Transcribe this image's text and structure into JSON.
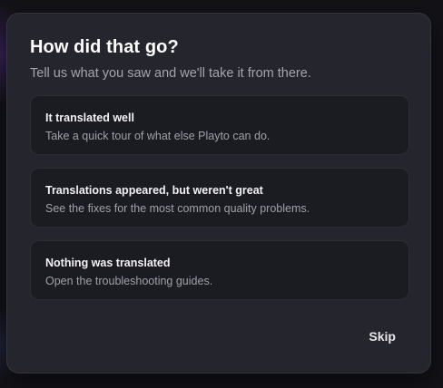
{
  "dialog": {
    "title": "How did that go?",
    "subtitle": "Tell us what you saw and we'll take it from there.",
    "options": [
      {
        "title": "It translated well",
        "description": "Take a quick tour of what else Playto can do."
      },
      {
        "title": "Translations appeared, but weren't great",
        "description": "See the fixes for the most common quality problems."
      },
      {
        "title": "Nothing was translated",
        "description": "Open the troubleshooting guides."
      }
    ],
    "skip_label": "Skip"
  }
}
